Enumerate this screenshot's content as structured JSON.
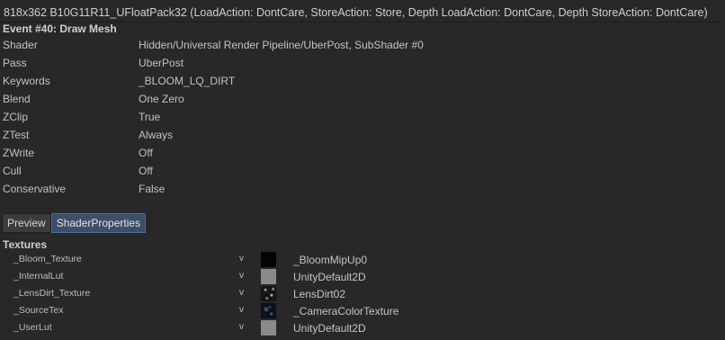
{
  "header": {
    "target_info": "818x362 B10G11R11_UFloatPack32 (LoadAction: DontCare, StoreAction: Store, Depth LoadAction: DontCare, Depth StoreAction: DontCare)"
  },
  "event": {
    "title": "Event #40: Draw Mesh"
  },
  "properties": [
    {
      "key": "Shader",
      "value": "Hidden/Universal Render Pipeline/UberPost, SubShader #0"
    },
    {
      "key": "Pass",
      "value": "UberPost"
    },
    {
      "key": "Keywords",
      "value": "_BLOOM_LQ_DIRT"
    },
    {
      "key": "Blend",
      "value": "One Zero"
    },
    {
      "key": "ZClip",
      "value": "True"
    },
    {
      "key": "ZTest",
      "value": "Always"
    },
    {
      "key": "ZWrite",
      "value": "Off"
    },
    {
      "key": "Cull",
      "value": "Off"
    },
    {
      "key": "Conservative",
      "value": "False"
    }
  ],
  "tabs": [
    {
      "label": "Preview",
      "active": false
    },
    {
      "label": "ShaderProperties",
      "active": true
    }
  ],
  "textures": {
    "heading": "Textures",
    "items": [
      {
        "name": "_Bloom_Texture",
        "stage": "v",
        "thumb": "black",
        "value": "_BloomMipUp0"
      },
      {
        "name": "_InternalLut",
        "stage": "v",
        "thumb": "gray",
        "value": "UnityDefault2D"
      },
      {
        "name": "_LensDirt_Texture",
        "stage": "v",
        "thumb": "dirt",
        "value": "LensDirt02"
      },
      {
        "name": "_SourceTex",
        "stage": "v",
        "thumb": "camera",
        "value": "_CameraColorTexture"
      },
      {
        "name": "_UserLut",
        "stage": "v",
        "thumb": "gray",
        "value": "UnityDefault2D"
      }
    ]
  }
}
